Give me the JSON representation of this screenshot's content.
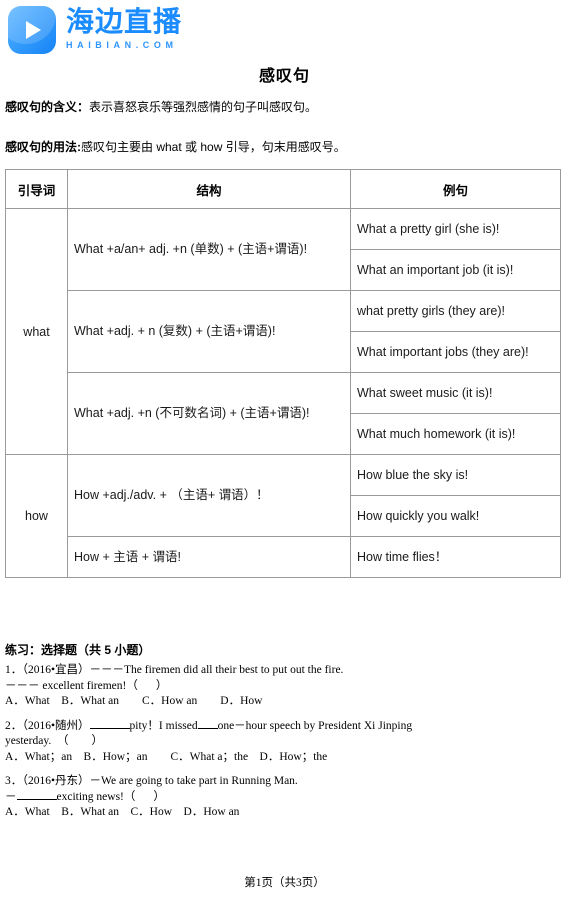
{
  "brand": {
    "logo_icon": "play-button-icon",
    "name_cn": "海边直播",
    "name_en": "HAIBIAN.COM",
    "accent_color": "#1a8cff"
  },
  "document": {
    "title": "感叹句",
    "definition_label": "感叹句的含义：",
    "definition_text": "表示喜怒哀乐等强烈感情的句子叫感叹句。",
    "usage_label": "感叹句的用法:",
    "usage_text": "感叹句主要由 what 或 how 引导，句末用感叹号。"
  },
  "table": {
    "headers": [
      "引导词",
      "结构",
      "例句"
    ],
    "groups": [
      {
        "guide": "what",
        "rows": [
          {
            "structure": "What +a/an+ adj. +n (单数) + (主语+谓语)!",
            "examples": [
              "What a pretty girl (she is)!",
              "What an important job (it is)!"
            ]
          },
          {
            "structure": "What +adj. + n (复数) + (主语+谓语)!",
            "examples": [
              "what pretty girls (they are)!",
              "What important jobs (they are)!"
            ]
          },
          {
            "structure": "What +adj. +n (不可数名词) + (主语+谓语)!",
            "examples": [
              "What sweet music (it is)!",
              "What much homework (it is)!"
            ]
          }
        ]
      },
      {
        "guide": "how",
        "rows": [
          {
            "structure": "How +adj./adv. +  （主语+ 谓语）！",
            "examples": [
              "How blue the sky is!",
              "How quickly you walk!"
            ]
          },
          {
            "structure": "How + 主语 + 谓语!",
            "examples": [
              "How time flies！"
            ]
          }
        ]
      }
    ]
  },
  "exercises": {
    "heading": "练习：选择题（共 5 小题）",
    "items": [
      {
        "number": "1．",
        "source": "（2016•宜昌）",
        "stem_part1": "－－－The firemen did all their best to put out the fire.",
        "stem_part2_pre": "－－－  excellent firemen!（",
        "stem_part2_post": "）",
        "options": "A．What　B．What an　　C．How an　　D．How"
      },
      {
        "number": "2．",
        "source": "（2016•随州）",
        "stem_part1_post": "pity！I missed",
        "stem_part1_tail": "one－hour speech by President Xi Jinping",
        "stem_part2": "yesterday.　（　　）",
        "options": "A．What；an　B．How；an　　C．What a；the　D．How；the"
      },
      {
        "number": "3．",
        "source": "（2016•丹东）",
        "stem_part1": "－We are going to take part in Running Man.",
        "stem_part2_pre": "－",
        "stem_part2_post": "exciting news!（",
        "stem_part2_end": "）",
        "options": "A．What　B．What an　C．How　D．How an"
      }
    ]
  },
  "footer": {
    "page_info": "第1页（共3页）"
  }
}
